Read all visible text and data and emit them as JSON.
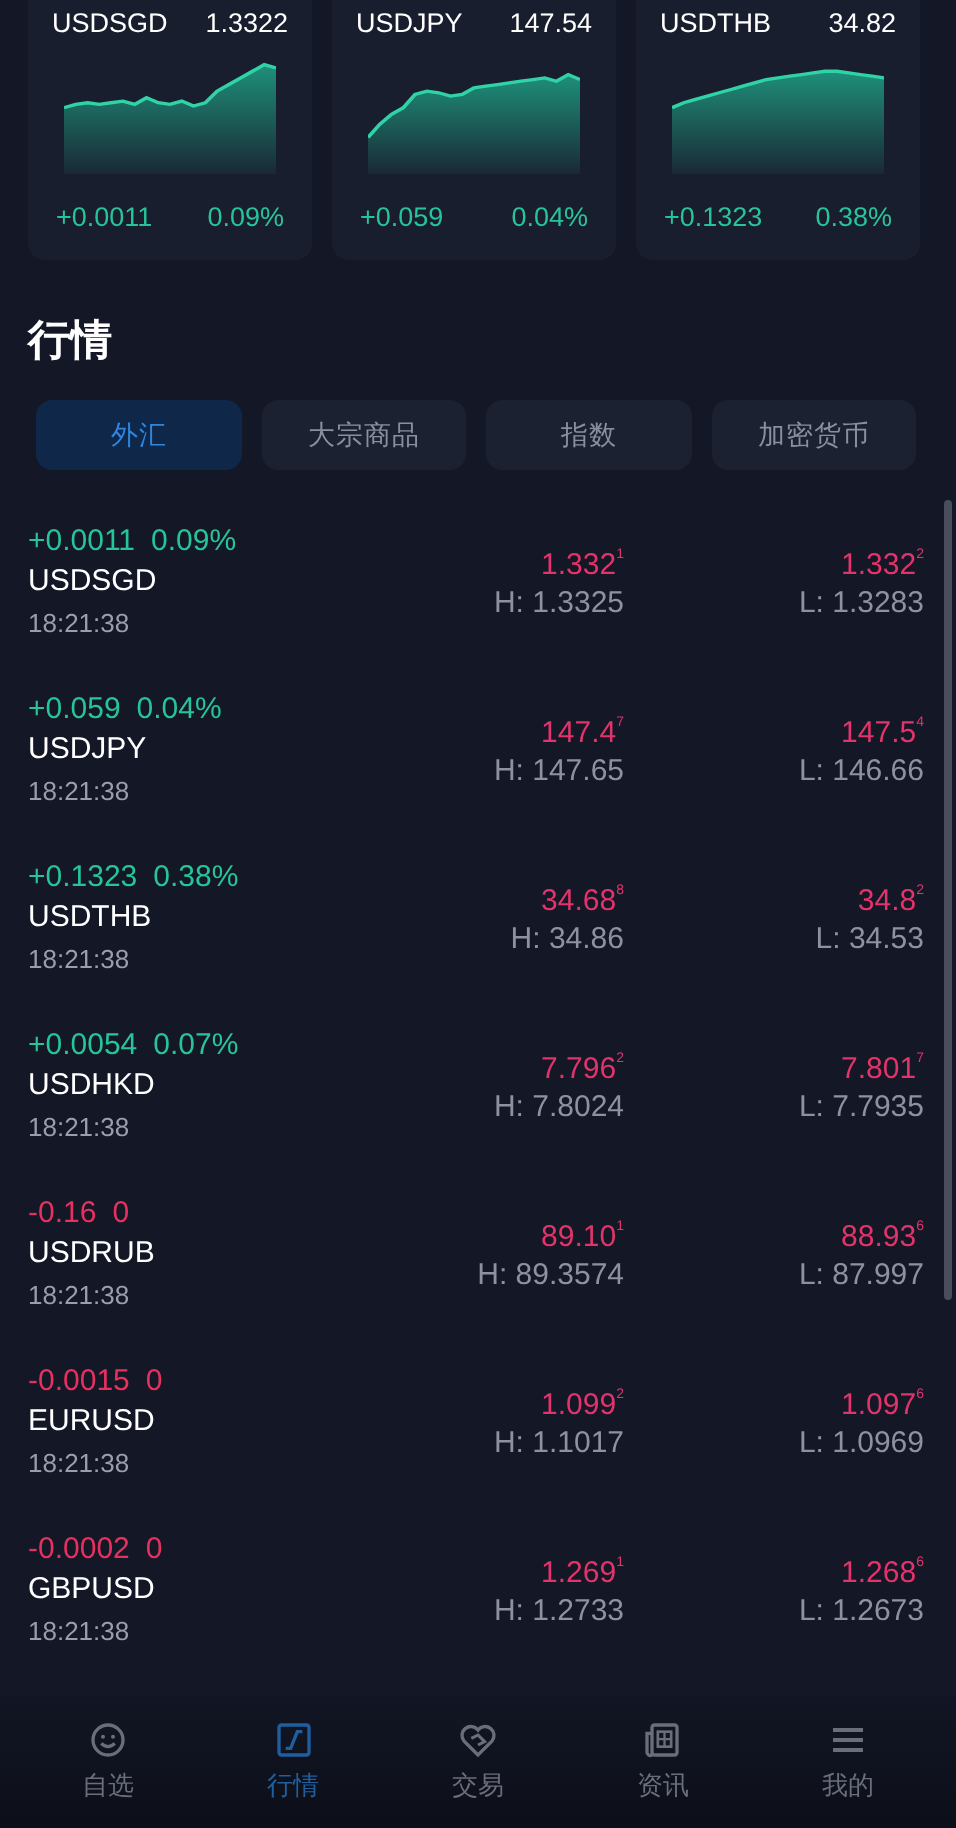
{
  "tickers": [
    {
      "symbol": "USDSGD",
      "price": "1.3322",
      "change": "+0.0011",
      "percent": "0.09%",
      "kind": "up"
    },
    {
      "symbol": "USDJPY",
      "price": "147.54",
      "change": "+0.059",
      "percent": "0.04%",
      "kind": "up"
    },
    {
      "symbol": "USDTHB",
      "price": "34.82",
      "change": "+0.1323",
      "percent": "0.38%",
      "kind": "up"
    }
  ],
  "section_title": "行情",
  "tabs": [
    {
      "label": "外汇",
      "selected": true
    },
    {
      "label": "大宗商品",
      "selected": false
    },
    {
      "label": "指数",
      "selected": false
    },
    {
      "label": "加密货币",
      "selected": false
    }
  ],
  "quotes": [
    {
      "change": "+0.0011",
      "percent": "0.09%",
      "kind": "up",
      "symbol": "USDSGD",
      "time": "18:21:38",
      "bid": "1.332$^{1}$",
      "high": "H: 1.3325",
      "ask": "1.332$^{2}$",
      "low": "L: 1.3283"
    },
    {
      "change": "+0.059",
      "percent": "0.04%",
      "kind": "up",
      "symbol": "USDJPY",
      "time": "18:21:38",
      "bid": "147.4$^{7}$",
      "high": "H: 147.65",
      "ask": "147.5$^{4}$",
      "low": "L: 146.66"
    },
    {
      "change": "+0.1323",
      "percent": "0.38%",
      "kind": "up",
      "symbol": "USDTHB",
      "time": "18:21:38",
      "bid": "34.68$^{8}$",
      "high": "H: 34.86",
      "ask": "34.8$^{2}$",
      "low": "L: 34.53"
    },
    {
      "change": "+0.0054",
      "percent": "0.07%",
      "kind": "up",
      "symbol": "USDHKD",
      "time": "18:21:38",
      "bid": "7.796$^{2}$",
      "high": "H: 7.8024",
      "ask": "7.801$^{7}$",
      "low": "L: 7.7935"
    },
    {
      "change": "-0.16",
      "percent": "0",
      "kind": "down",
      "symbol": "USDRUB",
      "time": "18:21:38",
      "bid": "89.10$^{1}$",
      "high": "H: 89.3574",
      "ask": "88.93$^{6}$",
      "low": "L: 87.997"
    },
    {
      "change": "-0.0015",
      "percent": "0",
      "kind": "down",
      "symbol": "EURUSD",
      "time": "18:21:38",
      "bid": "1.099$^{2}$",
      "high": "H: 1.1017",
      "ask": "1.097$^{6}$",
      "low": "L: 1.0969"
    },
    {
      "change": "-0.0002",
      "percent": "0",
      "kind": "down",
      "symbol": "GBPUSD",
      "time": "18:21:38",
      "bid": "1.269$^{1}$",
      "high": "H: 1.2733",
      "ask": "1.268$^{6}$",
      "low": "L: 1.2673"
    }
  ],
  "nav": [
    {
      "label": "自选",
      "selected": false
    },
    {
      "label": "行情",
      "selected": true
    },
    {
      "label": "交易",
      "selected": false
    },
    {
      "label": "资讯",
      "selected": false
    },
    {
      "label": "我的",
      "selected": false
    }
  ]
}
